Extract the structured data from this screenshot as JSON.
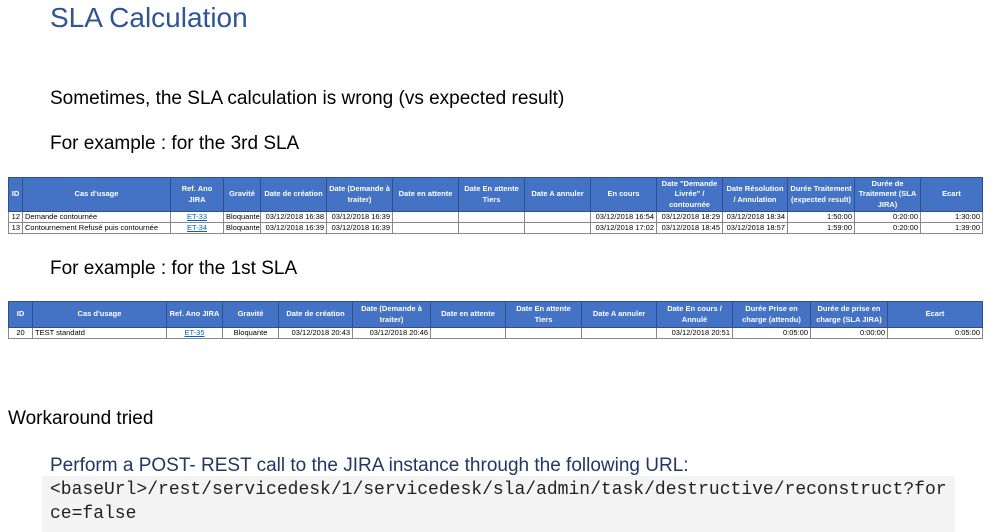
{
  "title": "SLA Calculation",
  "intro": "Sometimes, the SLA calculation is wrong (vs expected result)",
  "example1": "For example : for the 3rd SLA",
  "example2": "For example : for the 1st SLA",
  "table1": {
    "headers": [
      "ID",
      "Cas d'usage",
      "Ref. Ano JIRA",
      "Gravité",
      "Date de création",
      "Date (Demande à traiter)",
      "Date en attente",
      "Date En attente Tiers",
      "Date A annuler",
      "En cours",
      "Date \"Demande Livrée\" / contournée",
      "Date Résolution / Annulation",
      "Durée Traitement (expected result)",
      "Durée de Traitement (SLA JIRA)",
      "Ecart"
    ],
    "rows": [
      [
        "12",
        "Demande contournée",
        "ET-33",
        "Bloquante",
        "03/12/2018 16:38",
        "03/12/2018 16:39",
        "",
        "",
        "",
        "03/12/2018 16:54",
        "03/12/2018 18:29",
        "03/12/2018 18:34",
        "1:50:00",
        "0:20:00",
        "1:30:00"
      ],
      [
        "13",
        "Contournement Refusé puis contournée",
        "ET-34",
        "Bloquante",
        "03/12/2018 16:39",
        "03/12/2018 16:39",
        "",
        "",
        "",
        "03/12/2018 17:02",
        "03/12/2018 18:45",
        "03/12/2018 18:57",
        "1:59:00",
        "0:20:00",
        "1:39:00"
      ]
    ]
  },
  "table2": {
    "headers": [
      "ID",
      "Cas d'usage",
      "Ref. Ano JIRA",
      "Gravité",
      "Date de création",
      "Date (Demande à traiter)",
      "Date en attente",
      "Date En attente Tiers",
      "Date A annuler",
      "Date En cours / Annulé",
      "Durée Prise en charge (attendu)",
      "Durée de prise en charge (SLA JIRA)",
      "Ecart"
    ],
    "rows": [
      [
        "20",
        "TEST standatd",
        "ET-35",
        "Bloquante",
        "03/12/2018 20:43",
        "03/12/2018 20:46",
        "",
        "",
        "",
        "03/12/2018 20:51",
        "0:05:00",
        "0:00:00",
        "0:05:00"
      ]
    ]
  },
  "workaround": "Workaround tried",
  "perform": "Perform a POST- REST call to the JIRA instance through the following URL:",
  "code": "<baseUrl>/rest/servicedesk/1/servicedesk/sla/admin/task/destructive/reconstruct?force=false"
}
